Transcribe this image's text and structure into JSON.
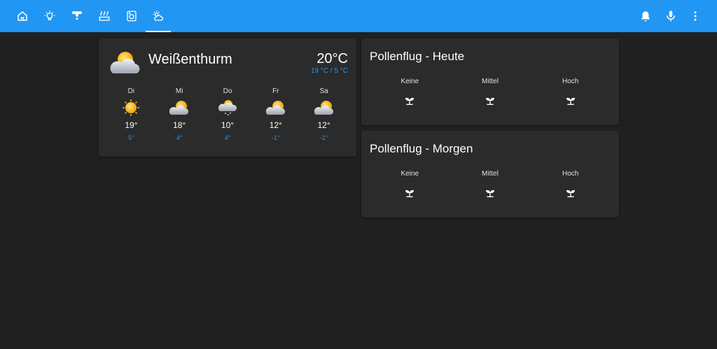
{
  "toolbar": {
    "tabs": [
      {
        "icon": "home-icon"
      },
      {
        "icon": "lightbulb-icon"
      },
      {
        "icon": "ceiling-light-icon"
      },
      {
        "icon": "radiator-icon"
      },
      {
        "icon": "washing-machine-icon"
      },
      {
        "icon": "weather-partly-cloudy-icon",
        "active": true
      }
    ],
    "actions": [
      {
        "icon": "bell-icon"
      },
      {
        "icon": "microphone-icon"
      },
      {
        "icon": "more-vertical-icon"
      }
    ],
    "bar_color": "#2196f3"
  },
  "weather": {
    "location": "Weißenthurm",
    "temperature": "20°C",
    "high_low": "19 °C / 5 °C",
    "current_icon": "partly-cloudy-icon",
    "forecast": [
      {
        "day": "Di",
        "high": "19°",
        "low": "5°",
        "icon": "sunny-icon"
      },
      {
        "day": "Mi",
        "high": "18°",
        "low": "4°",
        "icon": "partly-cloudy-icon"
      },
      {
        "day": "Do",
        "high": "10°",
        "low": "4°",
        "icon": "snow-cloud-icon"
      },
      {
        "day": "Fr",
        "high": "12°",
        "low": "-1°",
        "icon": "partly-cloudy-icon"
      },
      {
        "day": "Sa",
        "high": "12°",
        "low": "-1°",
        "icon": "partly-cloudy-icon"
      }
    ]
  },
  "pollen_today": {
    "title": "Pollenflug - Heute",
    "columns": [
      {
        "label": "Keine",
        "icon": "sprout-icon"
      },
      {
        "label": "Mittel",
        "icon": "sprout-icon"
      },
      {
        "label": "Hoch",
        "icon": "sprout-icon"
      }
    ]
  },
  "pollen_tomorrow": {
    "title": "Pollenflug - Morgen",
    "columns": [
      {
        "label": "Keine",
        "icon": "sprout-icon"
      },
      {
        "label": "Mittel",
        "icon": "sprout-icon"
      },
      {
        "label": "Hoch",
        "icon": "sprout-icon"
      }
    ]
  }
}
